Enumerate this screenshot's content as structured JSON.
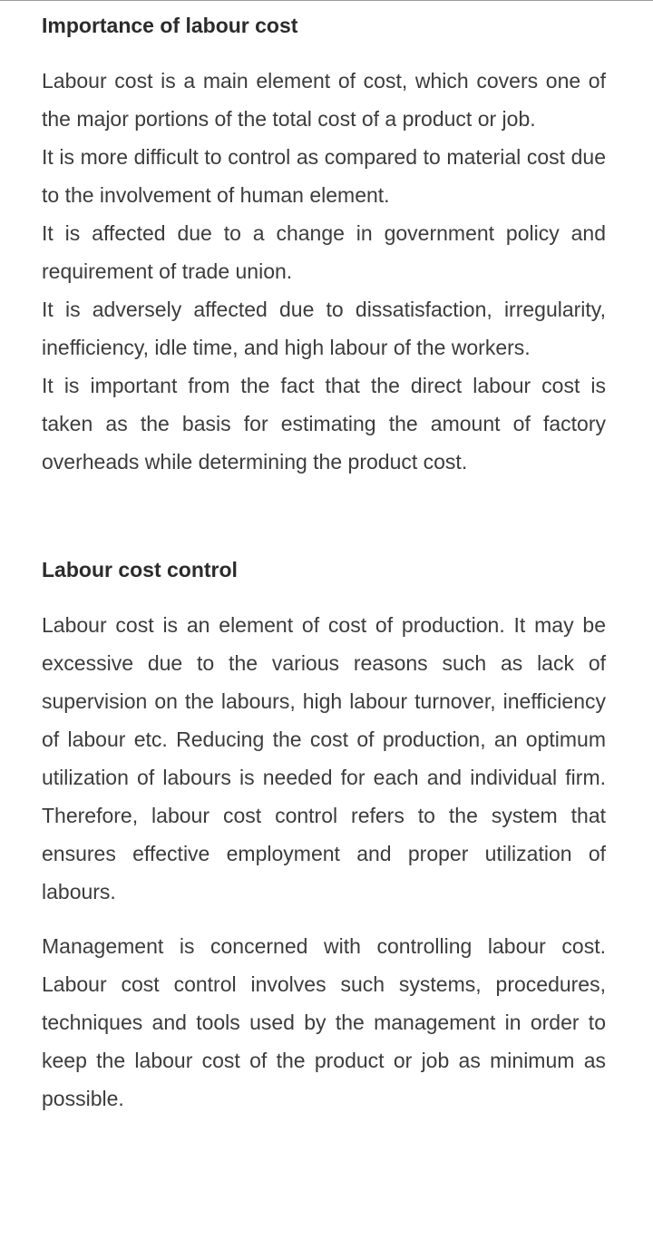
{
  "sections": [
    {
      "heading": "Importance of labour cost",
      "paragraphs": [
        "Labour cost is a main element of cost, which covers one of the major portions of the total cost of a product or job.",
        "It is more difficult to control as compared to material cost due to the involvement of human element.",
        "It is affected due to a change in government policy and requirement of trade union.",
        "It is adversely affected due to dissatisfaction, irregularity, inefficiency, idle time, and high labour of the workers.",
        "It is important from the fact that the direct labour cost is taken as the basis for estimating the amount of factory overheads while determining the product cost."
      ]
    },
    {
      "heading": "Labour cost control",
      "paragraphs": [
        "Labour cost is an element of cost of production. It may be excessive due to the various reasons such as lack of supervision on the labours, high labour turnover, inefficiency of labour etc. Reducing the cost of production, an optimum utilization of labours is needed for each and individual firm. Therefore, labour cost control refers to the system that ensures effective employment and proper utilization of labours.",
        "Management is concerned with controlling labour cost. Labour cost control involves such systems, procedures, techniques and tools used by the management in order to keep the labour cost of the product or job as minimum as possible."
      ]
    }
  ]
}
